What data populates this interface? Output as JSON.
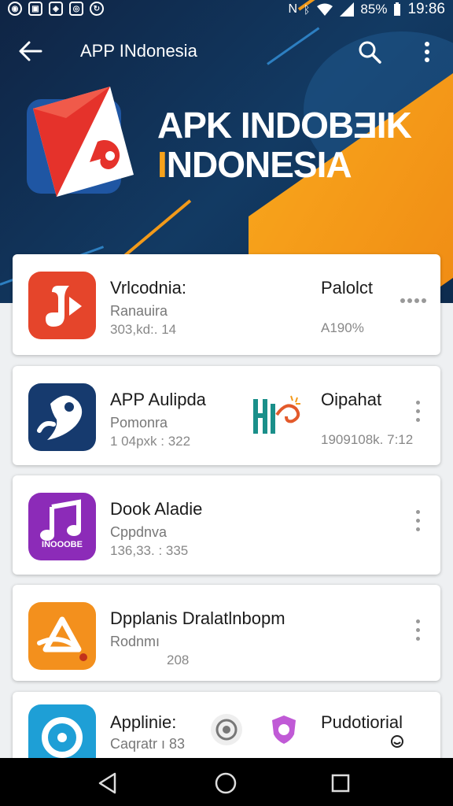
{
  "status_bar": {
    "battery": "85%",
    "time": "19:86"
  },
  "toolbar": {
    "title": "APP INdonesia"
  },
  "hero": {
    "line1": "APK INDOBƎIK",
    "line2_accent": "I",
    "line2_rest": "NDONESIA"
  },
  "apps": [
    {
      "name": "Vrlcodnia:",
      "sub": "Ranauira",
      "meta": "303,kd:. 14",
      "right_name": "Palolct",
      "right_meta": "A190%",
      "icon_color": "#e5452b"
    },
    {
      "name": "APP Aulipda",
      "sub": "Pomonra",
      "meta": "1 04pxk : 322",
      "right_name": "Oipahat",
      "right_meta": "1909108k. 7:12",
      "icon_color": "#163a6e"
    },
    {
      "name": "Dook Aladie",
      "sub": "Cppdnva",
      "meta": "136,33. : 335",
      "right_name": "",
      "right_meta": "",
      "icon_label": "INOOOBE",
      "icon_color": "#8c2bb8"
    },
    {
      "name": "Dpplanis Dralatlnbopm",
      "sub": "Rodnmı",
      "meta": "208",
      "right_name": "",
      "right_meta": "",
      "icon_color": "#f3901d"
    },
    {
      "name": "Applinie:",
      "sub": "Caqratr ı 83",
      "meta": "",
      "right_name": "Pudotiorial",
      "right_meta": "",
      "icon_color": "#1e9fd6"
    }
  ],
  "colors": {
    "hero_bg": "#0f2444",
    "accent": "#f7a21b",
    "card_bg": "#ffffff",
    "nav_bg": "#000000"
  }
}
